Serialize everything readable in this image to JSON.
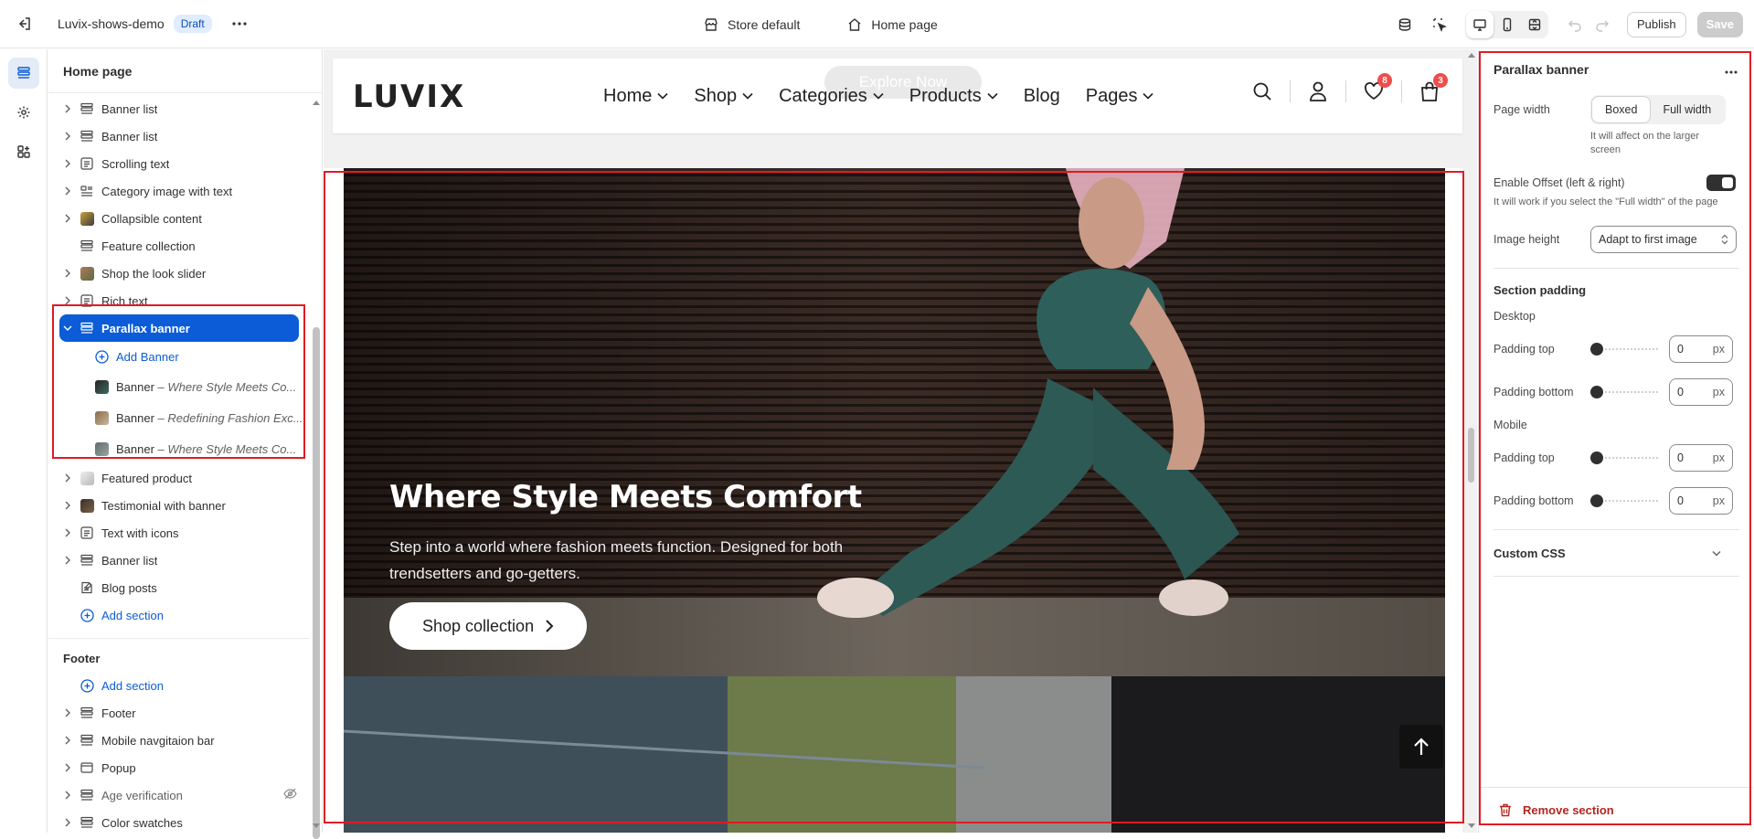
{
  "topbar": {
    "store_name": "Luvix-shows-demo",
    "status_badge": "Draft",
    "context_store": "Store default",
    "context_page": "Home page",
    "publish_label": "Publish",
    "save_label": "Save"
  },
  "sidebar": {
    "title": "Home page",
    "template_sections": [
      {
        "label": "Banner list",
        "icon": "banner-list-icon"
      },
      {
        "label": "Banner list",
        "icon": "banner-list-icon"
      },
      {
        "label": "Scrolling text",
        "icon": "text-block-icon"
      },
      {
        "label": "Category image with text",
        "icon": "image-text-icon"
      },
      {
        "label": "Collapsible content",
        "icon": "collapsible-thumb"
      },
      {
        "label": "Feature collection",
        "icon": "banner-list-icon"
      },
      {
        "label": "Shop the look slider",
        "icon": "shop-look-thumb"
      },
      {
        "label": "Rich text",
        "icon": "text-block-icon"
      }
    ],
    "selected_section": {
      "label": "Parallax banner",
      "add_block_label": "Add Banner",
      "blocks": [
        {
          "label": "Banner",
          "sep": " – ",
          "detail": "Where Style Meets Co..."
        },
        {
          "label": "Banner",
          "sep": " – ",
          "detail": "Redefining Fashion Exc..."
        },
        {
          "label": "Banner",
          "sep": " – ",
          "detail": "Where Style Meets Co..."
        }
      ]
    },
    "after_sections": [
      {
        "label": "Featured product"
      },
      {
        "label": "Testimonial with banner"
      },
      {
        "label": "Text with icons"
      },
      {
        "label": "Banner list"
      },
      {
        "label": "Blog posts"
      }
    ],
    "add_section_label": "Add section",
    "footer_group": {
      "title": "Footer",
      "add_section_label": "Add section",
      "sections": [
        {
          "label": "Footer"
        },
        {
          "label": "Mobile navgitaion bar"
        },
        {
          "label": "Popup"
        },
        {
          "label": "Age verification"
        },
        {
          "label": "Color swatches"
        }
      ]
    }
  },
  "preview": {
    "logo": "LUVIX",
    "explore_button": "Explore Now",
    "nav": [
      "Home",
      "Shop",
      "Categories",
      "Products",
      "Blog",
      "Pages"
    ],
    "nav_has_dropdown": [
      true,
      true,
      true,
      true,
      false,
      true
    ],
    "wishlist_count": "8",
    "cart_count": "3",
    "banner": {
      "title": "Where Style Meets Comfort",
      "description": "Step into a world where fashion meets function. Designed for both trendsetters and go-getters.",
      "button": "Shop collection"
    }
  },
  "settings": {
    "title": "Parallax banner",
    "page_width_label": "Page width",
    "page_width_options": [
      "Boxed",
      "Full width"
    ],
    "page_width_selected": "Boxed",
    "page_width_hint": "It will affect on the larger screen",
    "offset_label": "Enable Offset (left & right)",
    "offset_enabled": true,
    "offset_hint": "It will work if you select the \"Full width\" of the page",
    "image_height_label": "Image height",
    "image_height_value": "Adapt to first image",
    "section_padding_title": "Section padding",
    "desktop_label": "Desktop",
    "mobile_label": "Mobile",
    "padding_top_label": "Padding top",
    "padding_bottom_label": "Padding bottom",
    "desktop_padding_top": "0",
    "desktop_padding_bottom": "0",
    "mobile_padding_top": "0",
    "mobile_padding_bottom": "0",
    "unit": "px",
    "custom_css_label": "Custom CSS",
    "remove_section_label": "Remove section"
  },
  "colors": {
    "accent": "#0b5cd6",
    "highlight": "#e01b24",
    "danger": "#b3261e"
  }
}
